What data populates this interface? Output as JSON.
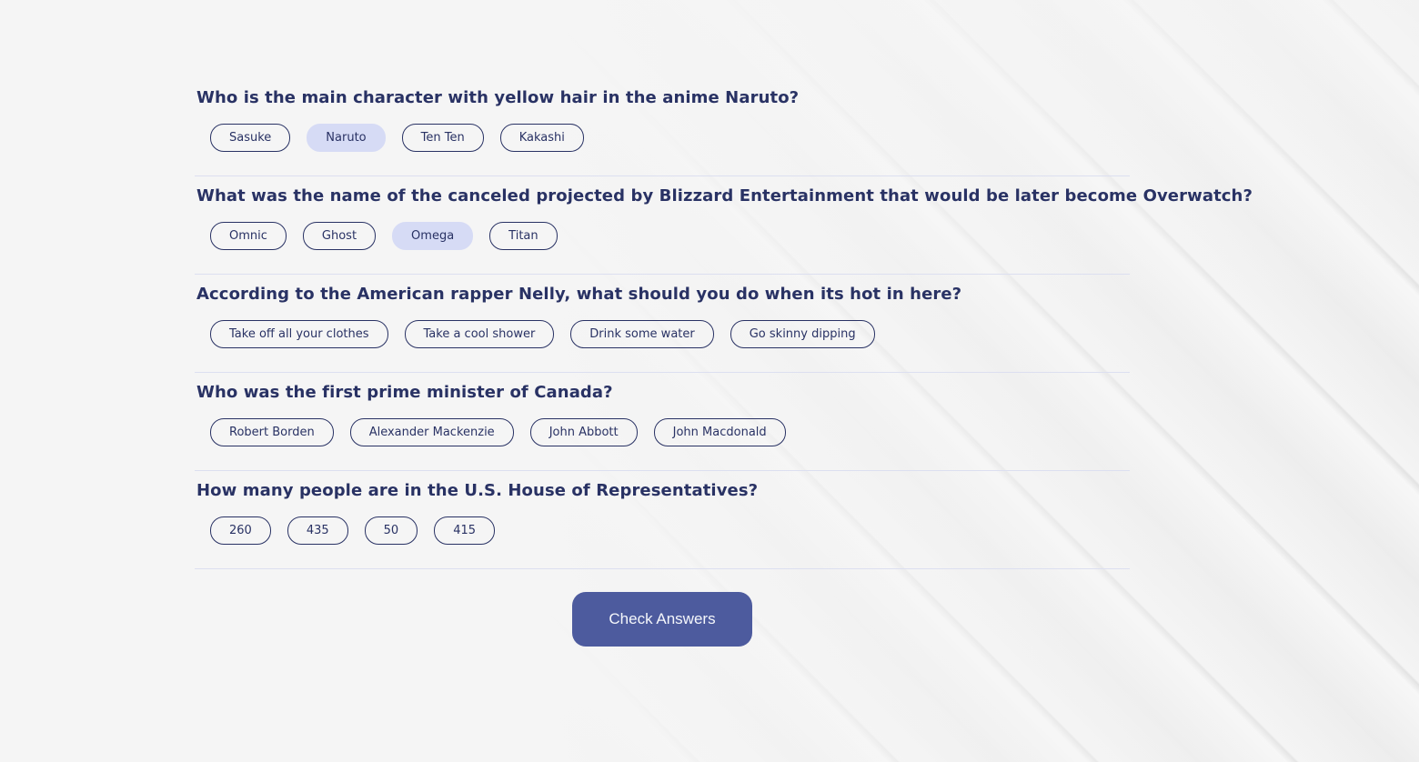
{
  "questions": [
    {
      "text": "Who is the main character with yellow hair in the anime Naruto?",
      "answers": [
        "Sasuke",
        "Naruto",
        "Ten Ten",
        "Kakashi"
      ],
      "selected_index": 1
    },
    {
      "text": "What was the name of the canceled projected by Blizzard Entertainment that would be later become Overwatch?",
      "answers": [
        "Omnic",
        "Ghost",
        "Omega",
        "Titan"
      ],
      "selected_index": 2
    },
    {
      "text": "According to the American rapper Nelly, what should you do when its hot in here?",
      "answers": [
        "Take off all your clothes",
        "Take a cool shower",
        "Drink some water",
        "Go skinny dipping"
      ],
      "selected_index": null
    },
    {
      "text": "Who was the first prime minister of Canada?",
      "answers": [
        "Robert Borden",
        "Alexander Mackenzie",
        "John Abbott",
        "John Macdonald"
      ],
      "selected_index": null
    },
    {
      "text": "How many people are in the U.S. House of Representatives?",
      "answers": [
        "260",
        "435",
        "50",
        "415"
      ],
      "selected_index": null
    }
  ],
  "check_button_label": "Check Answers",
  "colors": {
    "text": "#293264",
    "selected_answer_bg": "#d6dbf5",
    "button_bg": "#4d5b9e",
    "divider": "#dcdff0",
    "page_bg": "#f5f5f5"
  }
}
